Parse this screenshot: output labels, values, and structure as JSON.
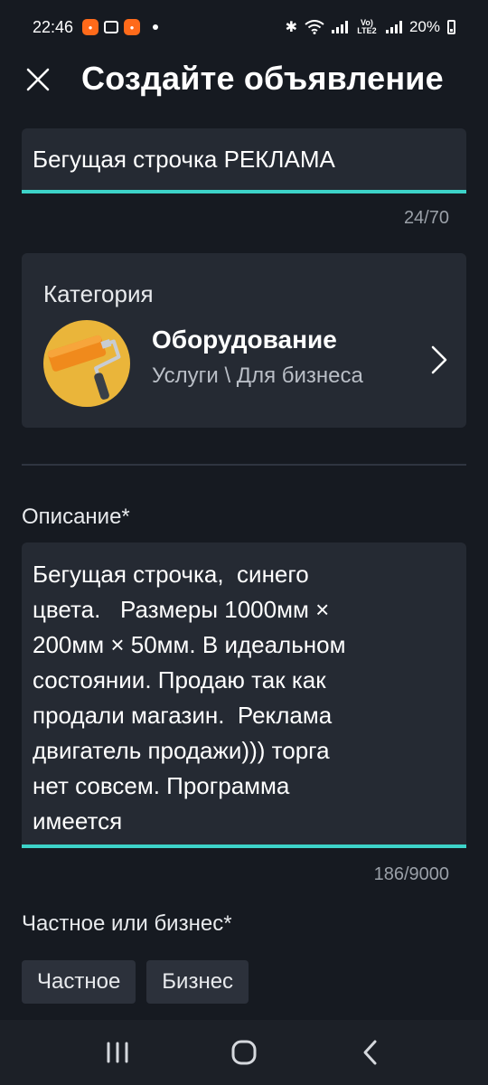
{
  "status_bar": {
    "time": "22:46",
    "battery": "20%",
    "network_label": "Vo) LTE2"
  },
  "header": {
    "title": "Создайте объявление"
  },
  "title_field": {
    "value": "Бегущая строчка РЕКЛАМА",
    "counter": "24/70"
  },
  "category": {
    "label": "Категория",
    "name": "Оборудование",
    "path": "Услуги \\ Для бизнеса"
  },
  "description": {
    "label": "Описание*",
    "value": "Бегущая строчка,  синего\nцвета.   Размеры 1000мм ×\n200мм × 50мм. В идеальном\nсостоянии. Продаю так как\nпродали магазин.  Реклама\nдвигатель продажи))) торга\nнет совсем. Программа\nимеется",
    "counter": "186/9000"
  },
  "seller_type": {
    "label": "Частное или бизнес*",
    "options": [
      "Частное",
      "Бизнес"
    ]
  },
  "colors": {
    "background": "#161a21",
    "field": "#252a33",
    "accent": "#3dd3c9",
    "category_avatar": "#eab53a"
  },
  "icons": [
    "close-icon",
    "chevron-right-icon",
    "paint-roller-icon",
    "recents-icon",
    "home-icon",
    "back-icon"
  ]
}
